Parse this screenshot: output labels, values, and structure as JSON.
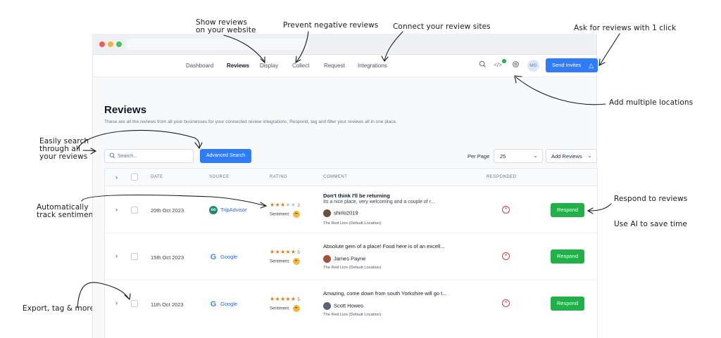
{
  "annotations": {
    "show_reviews": "Show reviews\non your website",
    "prevent_negative": "Prevent negative reviews",
    "connect_sites": "Connect your review sites",
    "ask_reviews": "Ask for reviews with 1 click",
    "add_locations": "Add multiple locations",
    "easily_search": "Easily search\nthrough all\nyour reviews",
    "track_sentiment": "Automatically\ntrack sentiment",
    "respond_reviews": "Respond to reviews",
    "use_ai": "Use AI to save time",
    "export_tag": "Export, tag & more"
  },
  "nav": {
    "items": [
      "Dashboard",
      "Reviews",
      "Display",
      "Collect",
      "Request",
      "Integrations"
    ],
    "active": "Reviews",
    "avatar_initials": "MG",
    "send_invites": "Send Invites",
    "icons": [
      "search-icon",
      "code-icon",
      "settings-icon"
    ]
  },
  "header": {
    "title": "Reviews",
    "subtitle": "These are all the reviews from all your businesses for your connected review integrations. Respond, tag and filter your reviews all in one place."
  },
  "toolbar": {
    "search_placeholder": "Search...",
    "advanced_search": "Advanced Search",
    "per_page_label": "Per Page",
    "per_page_value": "25",
    "add_reviews": "Add Reviews"
  },
  "table": {
    "columns": [
      "DATE",
      "SOURCE",
      "RATING",
      "COMMENT",
      "RESPONDED"
    ],
    "sentiment_label": "Sentiment:",
    "respond_label": "Respond",
    "rows": [
      {
        "date": "20th Oct 2023",
        "source": "TripAdvisor",
        "rating": 3,
        "rating_text": "3",
        "comment_title": "Don't think I'll be returning",
        "comment_body": "Its a nice place, very welcoming and a couple of r...",
        "author": "shirlo2019",
        "location": "The Red Lion (Default Location)",
        "responded": false
      },
      {
        "date": "15th Oct 2023",
        "source": "Google",
        "rating": 5,
        "rating_text": "5",
        "comment_title": "Absolute gem of a place! Food here is of an excell...",
        "comment_body": "",
        "author": "James Payne",
        "location": "The Red Lion (Default Location)",
        "responded": false
      },
      {
        "date": "11th Oct 2023",
        "source": "Google",
        "rating": 5,
        "rating_text": "5",
        "comment_title": "Amazing, come down from south Yorkshire will go t...",
        "comment_body": "",
        "author": "Scott Howes",
        "location": "The Red Lion (Default Location)",
        "responded": false
      }
    ]
  },
  "colors": {
    "primary": "#2f7cf6",
    "respond_green": "#22b04b",
    "star_orange": "#e07b1a",
    "error_red": "#e03a3a"
  }
}
